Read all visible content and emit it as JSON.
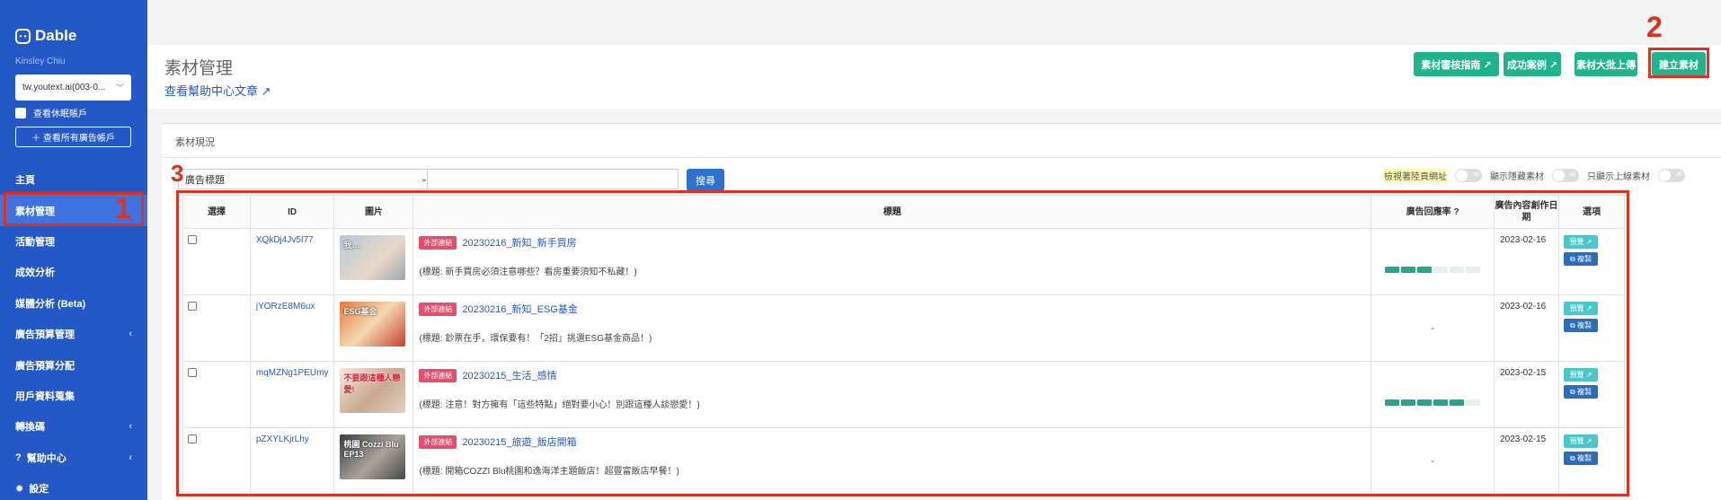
{
  "sidebar": {
    "logo": "Dable",
    "logo_mark": "• •",
    "user": "Kinsley Chiu",
    "account": "tw.youtext.ai(003-0...",
    "dormant_label": "查看休眠賬戶",
    "all_accounts_label": "＋ 查看所有廣告帳戶",
    "items": [
      {
        "label": "主頁",
        "arrow": ""
      },
      {
        "label": "素材管理",
        "arrow": ""
      },
      {
        "label": "活動管理",
        "arrow": ""
      },
      {
        "label": "成效分析",
        "arrow": ""
      },
      {
        "label": "媒體分析 (Beta)",
        "arrow": ""
      },
      {
        "label": "廣告預算管理",
        "arrow": "‹"
      },
      {
        "label": "廣告預算分配",
        "arrow": ""
      },
      {
        "label": "用戶資料蒐集",
        "arrow": ""
      },
      {
        "label": "轉換碼",
        "arrow": "‹"
      },
      {
        "label": "幫助中心",
        "arrow": "‹",
        "icon": "?"
      },
      {
        "label": "設定",
        "arrow": "",
        "icon": "✹"
      }
    ]
  },
  "header": {
    "title": "素材管理",
    "help_link": "查看幫助中心文章 ↗",
    "buttons": [
      "素材審核指南 ↗",
      "成功案例 ↗",
      "素材大批上傳",
      "建立素材"
    ]
  },
  "annotations": [
    "1",
    "2",
    "3"
  ],
  "content": {
    "section_label": "素材現況",
    "filter_value": "廣告標題",
    "search_button": "搜尋",
    "toggles": [
      {
        "label": "檢視著陸頁網址",
        "state": "off"
      },
      {
        "label": "顯示隱藏素材",
        "state": "off"
      },
      {
        "label": "只顯示上線素材",
        "state": "off"
      }
    ]
  },
  "table": {
    "headers": [
      "選擇",
      "ID",
      "圖片",
      "標題",
      "廣告回應率 ?",
      "廣告內容創作日期",
      "選項"
    ],
    "badge": "外部連結",
    "preview_label": "預覽 ↗",
    "copy_label": "⧉ 複製",
    "rows": [
      {
        "id": "XQkDj4Jv5I77",
        "thumb_text": "我…",
        "title": "20230216_新知_新手買房",
        "sub": "(標題: 新手買房必須注意哪些？看房重要須知不私藏！)",
        "rate": "",
        "date": "2023-02-16",
        "rate_filled": 3
      },
      {
        "id": "jYORzE8M6ux",
        "thumb_text": "ESG基金",
        "title": "20230216_新知_ESG基金",
        "sub": "(標題: 鈔票在手，環保要有！「2招」挑選ESG基金商品！)",
        "rate": "-",
        "date": "2023-02-16",
        "rate_filled": 0
      },
      {
        "id": "mqMZNg1PEUmy",
        "thumb_text": "不要跟這種人戀愛!",
        "title": "20230215_生活_感情",
        "sub": "(標題: 注意！對方擁有「這些特點」絕對要小心！別跟這種人談戀愛！)",
        "rate": "",
        "date": "2023-02-15",
        "rate_filled": 5
      },
      {
        "id": "pZXYLKjrLhy",
        "thumb_text": "桃園 Cozzi Blu EP13",
        "title": "20230215_旅遊_飯店開箱",
        "sub": "(標題: 開箱COZZI Blu桃園和逸海洋主題飯店！超豐富飯店早餐！)",
        "rate": "-",
        "date": "2023-02-15",
        "rate_filled": 0
      }
    ]
  },
  "colors": {
    "sidebar": "#2458c6",
    "accent_green": "#1fb38e",
    "highlight_red": "#e2301d",
    "badge_red": "#e54f6d",
    "link_blue": "#2458c6"
  }
}
